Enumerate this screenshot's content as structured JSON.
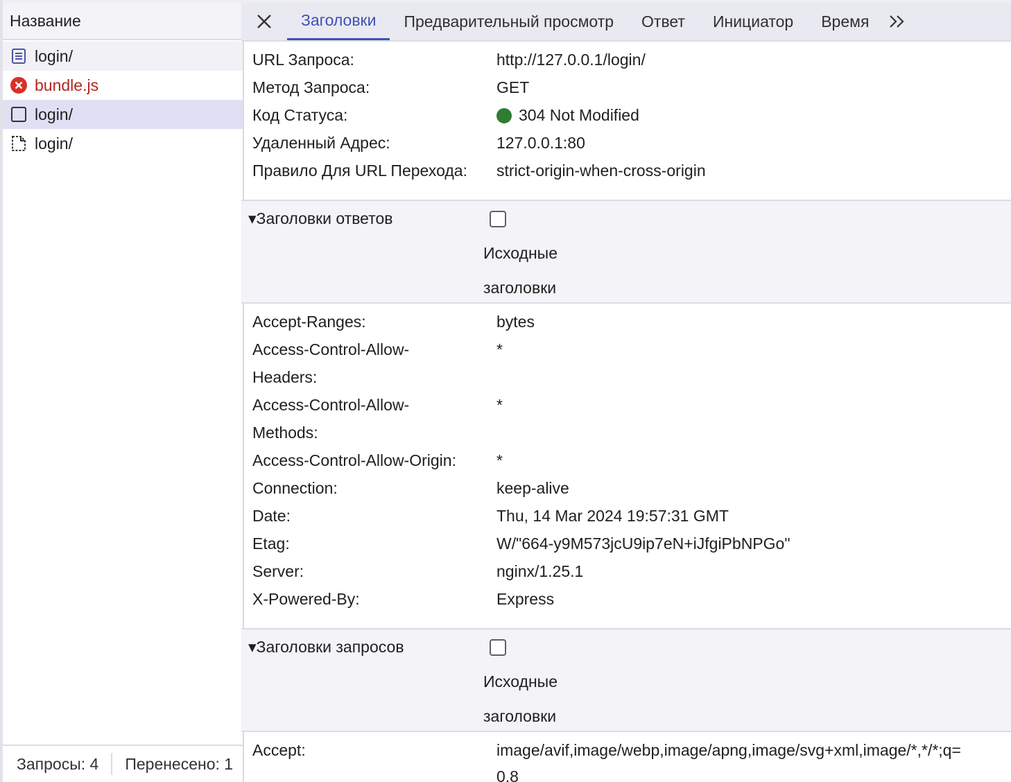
{
  "left": {
    "header": "Название",
    "requests": [
      {
        "name": "login/",
        "icon": "document-icon",
        "status": "ok"
      },
      {
        "name": "bundle.js",
        "icon": "error-icon",
        "status": "error"
      },
      {
        "name": "login/",
        "icon": "checkbox-icon",
        "status": "selected"
      },
      {
        "name": "login/",
        "icon": "file-icon",
        "status": "ok"
      }
    ],
    "footer": {
      "requests": "Запросы: 4",
      "transferred": "Перенесено: 1"
    }
  },
  "tabs": {
    "close_icon": "close-icon",
    "items": [
      "Заголовки",
      "Предварительный просмотр",
      "Ответ",
      "Инициатор",
      "Время"
    ],
    "active": "Заголовки",
    "more_icon": "chevron-double-right-icon"
  },
  "general": {
    "url_label": "URL Запроса:",
    "url_value": "http://127.0.0.1/login/",
    "method_label": "Метод Запроса:",
    "method_value": "GET",
    "status_label": "Код Статуса:",
    "status_value": "304 Not Modified",
    "status_color": "#2e7d32",
    "remote_label": "Удаленный Адрес:",
    "remote_value": "127.0.0.1:80",
    "referrer_label": "Правило Для URL Перехода:",
    "referrer_value": "strict-origin-when-cross-origin"
  },
  "response_section": {
    "title": "Заголовки ответов",
    "raw_line1": "Исходные",
    "raw_line2": "заголовки"
  },
  "response_headers": {
    "accept_ranges_k": "Accept-Ranges:",
    "accept_ranges_v": "bytes",
    "acah_k1": "Access-Control-Allow-",
    "acah_k2": "Headers:",
    "acah_v": "*",
    "acam_k1": "Access-Control-Allow-",
    "acam_k2": "Methods:",
    "acam_v": "*",
    "acao_k": "Access-Control-Allow-Origin:",
    "acao_v": "*",
    "connection_k": "Connection:",
    "connection_v": "keep-alive",
    "date_k": "Date:",
    "date_v": "Thu, 14 Mar 2024 19:57:31 GMT",
    "etag_k": "Etag:",
    "etag_v": "W/\"664-y9M573jcU9ip7eN+iJfgiPbNPGo\"",
    "server_k": "Server:",
    "server_v": "nginx/1.25.1",
    "powered_k": "X-Powered-By:",
    "powered_v": "Express"
  },
  "request_section": {
    "title": "Заголовки запросов",
    "raw_line1": "Исходные",
    "raw_line2": "заголовки"
  },
  "request_headers": {
    "accept_k": "Accept:",
    "accept_v1": "image/avif,image/webp,image/apng,image/svg+xml,image/*,*/*;q=",
    "accept_v2": "0.8"
  }
}
